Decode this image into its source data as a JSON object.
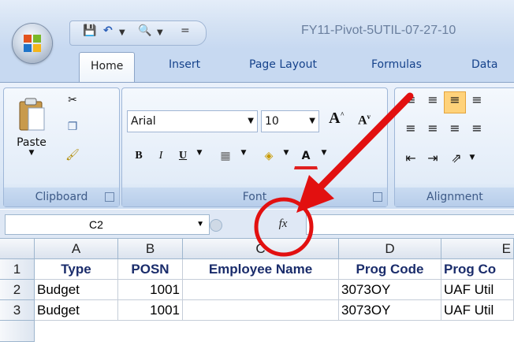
{
  "window": {
    "title": "FY11-Pivot-5UTIL-07-27-10"
  },
  "quick_access": {
    "separator": "="
  },
  "tabs": [
    {
      "label": "Home"
    },
    {
      "label": "Insert"
    },
    {
      "label": "Page Layout"
    },
    {
      "label": "Formulas"
    },
    {
      "label": "Data"
    }
  ],
  "clipboard": {
    "paste_label": "Paste",
    "group_label": "Clipboard"
  },
  "font": {
    "font_name": "Arial",
    "font_size": "10",
    "bold": "B",
    "italic": "I",
    "underline": "U",
    "group_label": "Font"
  },
  "alignment": {
    "group_label": "Alignment"
  },
  "formula_bar": {
    "name_box": "C2",
    "fx_label": "fx",
    "formula": ""
  },
  "sheet": {
    "columns": [
      "A",
      "B",
      "C",
      "D",
      "E"
    ],
    "rows": [
      {
        "num": "1",
        "cells": [
          "Type",
          "POSN",
          "Employee Name",
          "Prog Code",
          "Prog Co"
        ]
      },
      {
        "num": "2",
        "cells": [
          "Budget",
          "1001",
          "",
          "3073OY",
          "UAF Util"
        ]
      },
      {
        "num": "3",
        "cells": [
          "Budget",
          "1001",
          "",
          "3073OY",
          "UAF Util"
        ]
      }
    ]
  },
  "colors": {
    "annotation": "#e21010",
    "ribbon": "#dbe7f6",
    "header_text": "#1a2c6b"
  }
}
